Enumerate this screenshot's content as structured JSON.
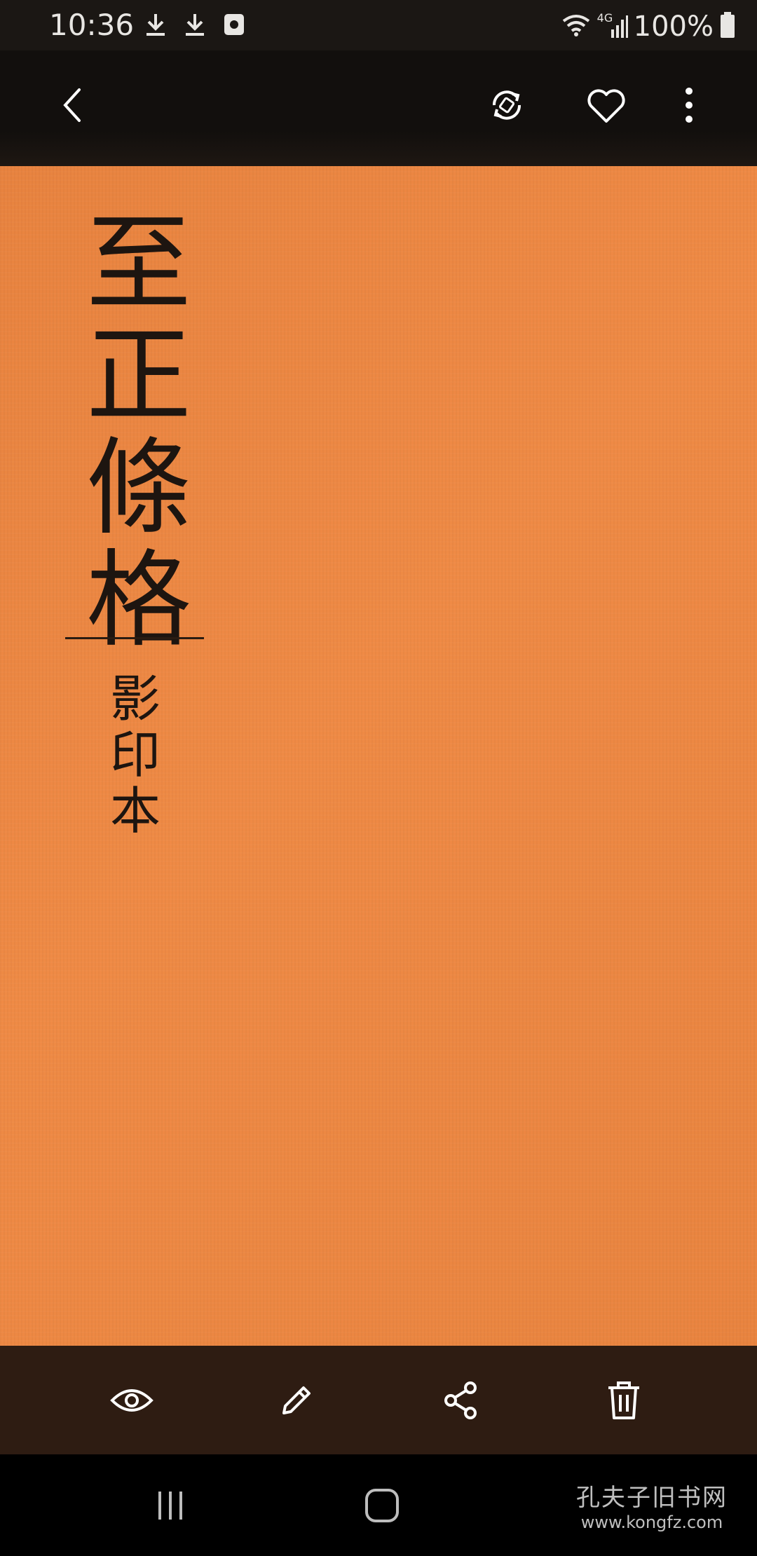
{
  "status_bar": {
    "time": "10:36",
    "icons_left": [
      "download-icon",
      "download-icon",
      "screenshot-app-icon"
    ],
    "network_label": "4G",
    "battery_percent": "100%"
  },
  "app_bar": {
    "icons": [
      "back-arrow-icon",
      "rotate-icon",
      "heart-icon",
      "more-options-icon"
    ]
  },
  "image": {
    "title_chars": [
      "至",
      "正",
      "條",
      "格"
    ],
    "subtitle_chars": [
      "影",
      "印",
      "本"
    ],
    "cover_color": "#ec873f",
    "ink_color": "#1d1510"
  },
  "bottom_actions": {
    "icons": [
      "eye-icon",
      "edit-pencil-icon",
      "share-icon",
      "trash-icon"
    ]
  },
  "nav_bar": {
    "icons": [
      "recent-apps-icon",
      "home-icon"
    ]
  },
  "watermark": {
    "chinese": "孔夫子旧书网",
    "url": "www.kongfz.com"
  }
}
